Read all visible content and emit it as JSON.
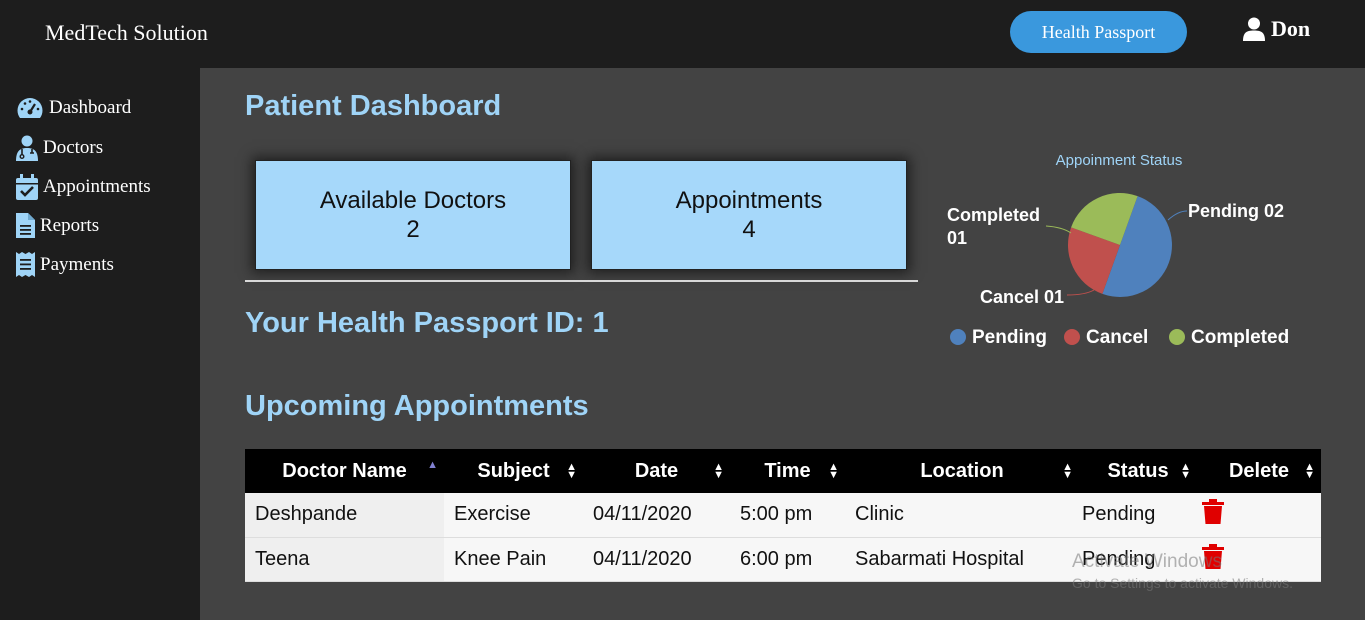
{
  "header": {
    "brand": "MedTech Solution",
    "passport_button": "Health Passport",
    "user_name": "Don"
  },
  "sidebar": {
    "items": [
      {
        "label": "Dashboard",
        "icon": "dashboard-gauge-icon"
      },
      {
        "label": "Doctors",
        "icon": "doctor-icon"
      },
      {
        "label": "Appointments",
        "icon": "calendar-check-icon"
      },
      {
        "label": "Reports",
        "icon": "file-icon"
      },
      {
        "label": "Payments",
        "icon": "receipt-icon"
      }
    ]
  },
  "main": {
    "title": "Patient Dashboard",
    "cards": [
      {
        "label": "Available Doctors",
        "value": "2"
      },
      {
        "label": "Appointments",
        "value": "4"
      }
    ],
    "passport_id": "Your Health Passport ID: 1",
    "upcoming_title": "Upcoming Appointments"
  },
  "chart_data": {
    "type": "pie",
    "title": "Appoinment Status",
    "categories": [
      "Pending",
      "Cancel",
      "Completed"
    ],
    "values": [
      2,
      1,
      1
    ],
    "slice_labels": [
      "Pending 02",
      "Cancel 01",
      "Completed 01"
    ],
    "colors": [
      "#4f81bd",
      "#c0504d",
      "#9bbb59"
    ],
    "legend": "bottom"
  },
  "table": {
    "columns": [
      "Doctor Name",
      "Subject",
      "Date",
      "Time",
      "Location",
      "Status",
      "Delete"
    ],
    "rows": [
      {
        "doctor": "Deshpande",
        "subject": "Exercise",
        "date": "04/11/2020",
        "time": "5:00 pm",
        "location": "Clinic",
        "status": "Pending"
      },
      {
        "doctor": "Teena",
        "subject": "Knee Pain",
        "date": "04/11/2020",
        "time": "6:00 pm",
        "location": "Sabarmati Hospital",
        "status": "Pending"
      }
    ]
  },
  "watermark": {
    "line1": "Activate Windows",
    "line2": "Go to Settings to activate Windows."
  },
  "colors": {
    "accent": "#3a98dd",
    "heading": "#9fd4f7",
    "card": "#a6d8fa",
    "delete": "#e00000"
  }
}
